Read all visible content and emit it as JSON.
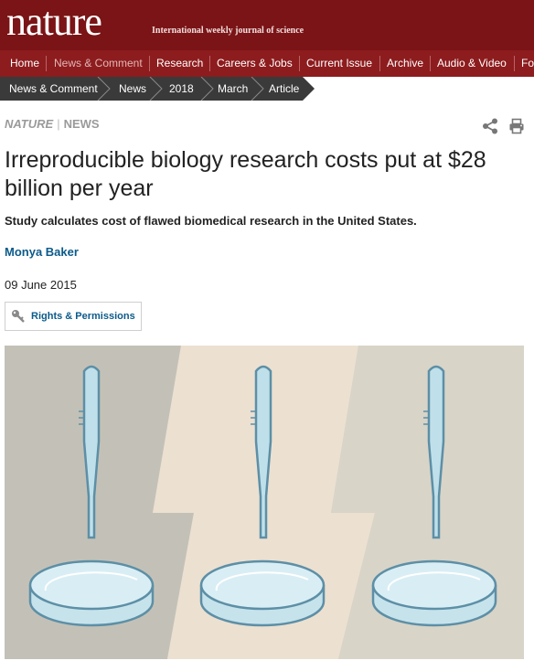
{
  "masthead": {
    "logo": "nature",
    "tagline": "International weekly journal of science"
  },
  "nav": {
    "items": [
      "Home",
      "News & Comment",
      "Research",
      "Careers & Jobs",
      "Current Issue",
      "Archive",
      "Audio & Video",
      "Fo"
    ],
    "active": "News & Comment"
  },
  "breadcrumb": [
    "News & Comment",
    "News",
    "2018",
    "March",
    "Article"
  ],
  "article": {
    "kicker_journal": "NATURE",
    "kicker_section": "NEWS",
    "title": "Irreproducible biology research costs put at $28 billion per year",
    "standfirst": "Study calculates cost of flawed biomedical research in the United States.",
    "author": "Monya Baker",
    "date": "09 June 2015",
    "rights_label": "Rights & Permissions"
  },
  "icons": {
    "share": "share-icon",
    "print": "print-icon",
    "key": "key-icon"
  },
  "colors": {
    "masthead": "#7a1416",
    "nav": "#8d1c1e",
    "breadcrumb": "#333333",
    "link": "#0b5a8a"
  }
}
